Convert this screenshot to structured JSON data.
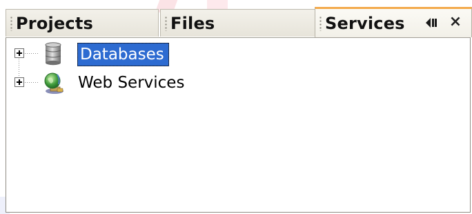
{
  "tabs": [
    {
      "label": "Projects",
      "active": false
    },
    {
      "label": "Files",
      "active": false
    },
    {
      "label": "Services",
      "active": true
    }
  ],
  "window_controls": {
    "minimize_icon": "minimize-window-icon",
    "close_label": "×"
  },
  "tree": {
    "nodes": [
      {
        "label": "Databases",
        "icon": "database-icon",
        "expanded": false,
        "selected": true
      },
      {
        "label": "Web Services",
        "icon": "web-services-icon",
        "expanded": false,
        "selected": false
      }
    ]
  },
  "colors": {
    "active_tab_accent": "#f3a94a",
    "selection_background": "#2d6bd1",
    "selection_text": "#ffffff"
  }
}
